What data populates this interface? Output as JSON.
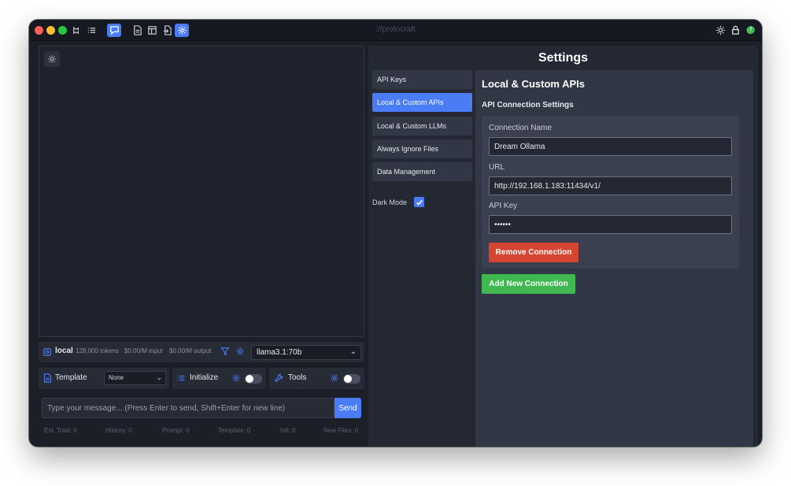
{
  "window": {
    "title": "://protocraft"
  },
  "colors": {
    "accent": "#4a7cf6",
    "danger": "#d64532",
    "success": "#3fb950"
  },
  "toolbar": {
    "icons": [
      "tree-icon",
      "list-icon",
      "chat-icon",
      "document-icon",
      "layout-icon",
      "export-icon",
      "gear-icon"
    ],
    "right_icons": [
      "sun-icon",
      "lock-icon",
      "power-icon"
    ],
    "notification_badge": "!"
  },
  "model_bar": {
    "provider": "local",
    "tokens": "128,000 tokens",
    "input_price": "$0.00/M input",
    "output_price": "$0.00/M output",
    "selected_model": "llama3.1:70b"
  },
  "options": {
    "template_label": "Template",
    "template_value": "None",
    "initialize_label": "Initialize",
    "tools_label": "Tools"
  },
  "composer": {
    "placeholder": "Type your message... (Press Enter to send, Shift+Enter for new line)",
    "send_label": "Send"
  },
  "stats": {
    "est_total": "Est. Total: 0",
    "history": "History: 0",
    "prompt": "Prompt: 0",
    "template": "Template: 0",
    "init": "Init: 0",
    "new_files": "New Files: 0"
  },
  "settings": {
    "title": "Settings",
    "nav": [
      {
        "label": "API Keys",
        "active": false
      },
      {
        "label": "Local & Custom APIs",
        "active": true
      },
      {
        "label": "Local & Custom LLMs",
        "active": false
      },
      {
        "label": "Always Ignore Files",
        "active": false
      },
      {
        "label": "Data Management",
        "active": false
      }
    ],
    "dark_mode_label": "Dark Mode",
    "dark_mode_checked": true,
    "section_title": "Local & Custom APIs",
    "subsection_title": "API Connection Settings",
    "connection": {
      "name_label": "Connection Name",
      "name_value": "Dream Ollama",
      "url_label": "URL",
      "url_value": "http://192.168.1.183:11434/v1/",
      "key_label": "API Key",
      "key_value": "••••••"
    },
    "remove_label": "Remove Connection",
    "add_label": "Add New Connection"
  }
}
